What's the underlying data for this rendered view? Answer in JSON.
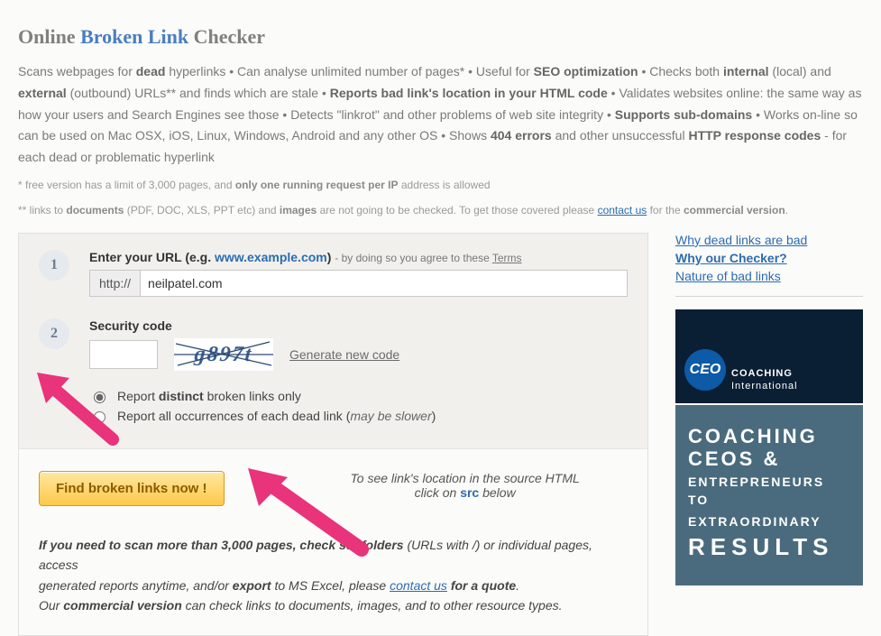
{
  "title": {
    "online": "Online",
    "broken": "Broken Link",
    "checker": "Checker"
  },
  "intro": {
    "t1": "Scans webpages for ",
    "b1": "dead",
    "t2": " hyperlinks • Can analyse unlimited number of pages* • Useful for ",
    "b2": "SEO optimization",
    "t3": " • Checks both ",
    "b3": "internal",
    "t4": " (local) and ",
    "b4": "external",
    "t5": " (outbound) URLs** and finds which are stale • ",
    "b5": "Reports bad link's location in your HTML code",
    "t6": " • Validates websites online: the same way as how your users and Search Engines see those • Detects \"linkrot\" and other problems of web site integrity • ",
    "b6": "Supports sub-domains",
    "t7": " • Works on-line so can be used on Mac OSX, iOS, Linux, Windows, Android and any other OS • Shows ",
    "b7": "404 errors",
    "t8": " and other unsuccessful ",
    "b8": "HTTP response codes",
    "t9": " - for each dead or problematic hyperlink"
  },
  "fn1": {
    "a": "* ",
    "t1": " free version has a limit of 3,000 pages, and ",
    "b1": "only one running request per IP",
    "t2": " address is allowed"
  },
  "fn2": {
    "a": "** links to ",
    "b1": "documents",
    "t1": " (PDF, DOC, XLS, PPT etc) and ",
    "b2": "images",
    "t2": " are not going to be checked. To get those covered please ",
    "link": "contact us",
    "t3": " for the ",
    "b3": "commercial version",
    "dot": "."
  },
  "step1": {
    "num": "1",
    "label_a": "Enter your URL (e.g. ",
    "label_eg": "www.example.com",
    "label_b": ") ",
    "sub": "- by doing so you agree to these ",
    "terms": "Terms",
    "scheme": "http://",
    "value": "neilpatel.com"
  },
  "step2": {
    "num": "2",
    "label": "Security code",
    "captcha": "g897t",
    "gen": "Generate new code"
  },
  "opts": {
    "o1a": "Report ",
    "o1b": "distinct",
    "o1c": " broken links only",
    "o2a": "Report all occurrences of each dead link (",
    "o2b": "may be slower",
    "o2c": ")"
  },
  "action": {
    "btn": "Find broken links now !",
    "hint1": "To see link's location in the source HTML",
    "hint2a": "click on ",
    "src": "src",
    "hint2b": " below"
  },
  "more": {
    "t1": "If you need to scan more than 3,000 pages, check subfolders",
    "t2": " (URLs with /) or individual pages, access",
    "t3": "generated reports anytime, and/or ",
    "b2": "export",
    "t4": " to MS Excel, please ",
    "link": "contact us",
    "b3": " for a quote",
    "dot": ".",
    "t5": "Our ",
    "b4": "commercial version",
    "t6": " can check links to documents, images, and to other resource types."
  },
  "side": {
    "l1": "Why dead links are bad",
    "l2": "Why our Checker?",
    "l3": "Nature of bad links"
  },
  "ad": {
    "ceo": "CEO",
    "brand1": "COACHING",
    "brand2": "International",
    "h1": "COACHING",
    "h2": "CEOS &",
    "h3": "ENTREPRENEURS TO",
    "h4": "EXTRAORDINARY",
    "h5": "RESULTS"
  }
}
